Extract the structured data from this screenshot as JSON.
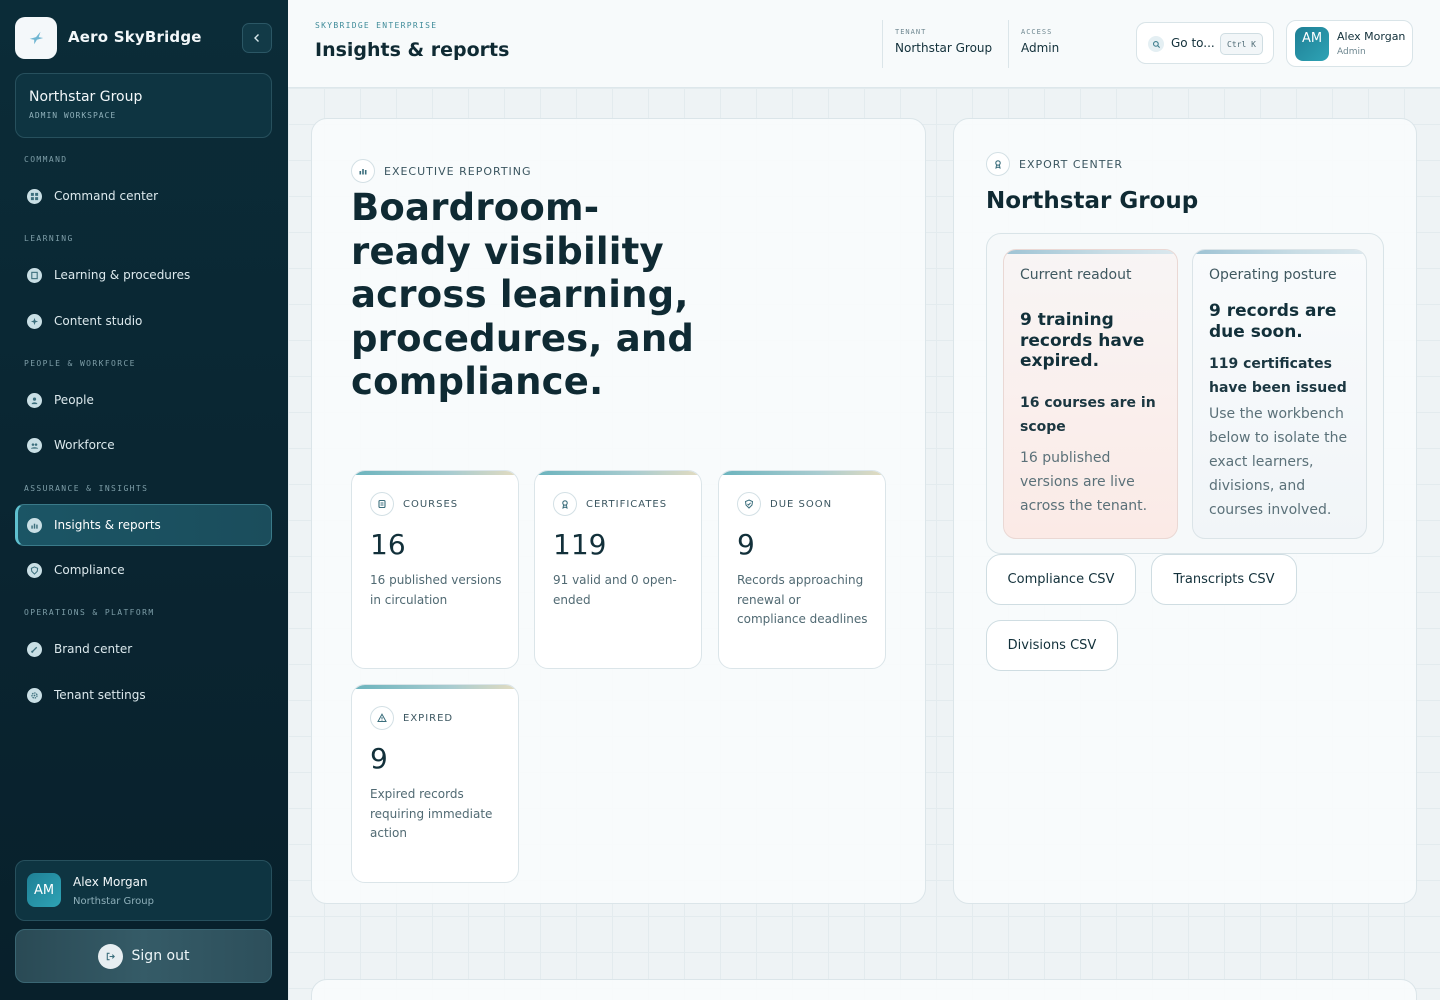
{
  "brand": {
    "name": "Aero SkyBridge"
  },
  "workspace": {
    "name": "Northstar Group",
    "subtitle": "ADMIN WORKSPACE"
  },
  "nav": {
    "sections": {
      "command": "COMMAND",
      "learning": "LEARNING",
      "people": "PEOPLE & WORKFORCE",
      "assurance": "ASSURANCE & INSIGHTS",
      "operations": "OPERATIONS & PLATFORM"
    },
    "items": {
      "command_center": "Command center",
      "learning_procedures": "Learning & procedures",
      "content_studio": "Content studio",
      "people": "People",
      "workforce": "Workforce",
      "insights_reports": "Insights & reports",
      "compliance": "Compliance",
      "brand_center": "Brand center",
      "tenant_settings": "Tenant settings"
    }
  },
  "sidebar_user": {
    "initials": "AM",
    "name": "Alex Morgan",
    "org": "Northstar Group"
  },
  "signout": {
    "label": "Sign out"
  },
  "header": {
    "eyebrow": "SKYBRIDGE ENTERPRISE",
    "title": "Insights & reports",
    "tenant_label": "TENANT",
    "tenant_value": "Northstar Group",
    "access_label": "ACCESS",
    "access_value": "Admin",
    "goto_label": "Go to...",
    "shortcut": "Ctrl K",
    "user_initials": "AM",
    "user_name": "Alex Morgan",
    "user_role": "Admin"
  },
  "executive": {
    "eyebrow": "EXECUTIVE REPORTING",
    "headline": "Boardroom-ready visibility across learning, procedures, and compliance.",
    "stats": {
      "courses": {
        "label": "COURSES",
        "value": "16",
        "desc": "16 published versions in circulation"
      },
      "certificates": {
        "label": "CERTIFICATES",
        "value": "119",
        "desc": "91 valid and 0 open-ended"
      },
      "due_soon": {
        "label": "DUE SOON",
        "value": "9",
        "desc": "Records approaching renewal or compliance deadlines"
      },
      "expired": {
        "label": "EXPIRED",
        "value": "9",
        "desc": "Expired records requiring immediate action"
      }
    }
  },
  "export": {
    "eyebrow": "EXPORT CENTER",
    "title": "Northstar Group",
    "current": {
      "label": "Current readout",
      "headline": "9 training records have expired.",
      "strong": "16 courses are in scope",
      "desc": "16 published versions are live across the tenant."
    },
    "posture": {
      "label": "Operating posture",
      "headline": "9 records are due soon.",
      "strong": "119 certificates have been issued",
      "desc": "Use the workbench below to isolate the exact learners, divisions, and courses involved."
    },
    "buttons": {
      "compliance": "Compliance CSV",
      "transcripts": "Transcripts CSV",
      "divisions": "Divisions CSV"
    }
  },
  "colors": {
    "sidebar": "#0b2c38",
    "accent": "#5fc0cf",
    "alert_tint": "#fbeae6"
  }
}
